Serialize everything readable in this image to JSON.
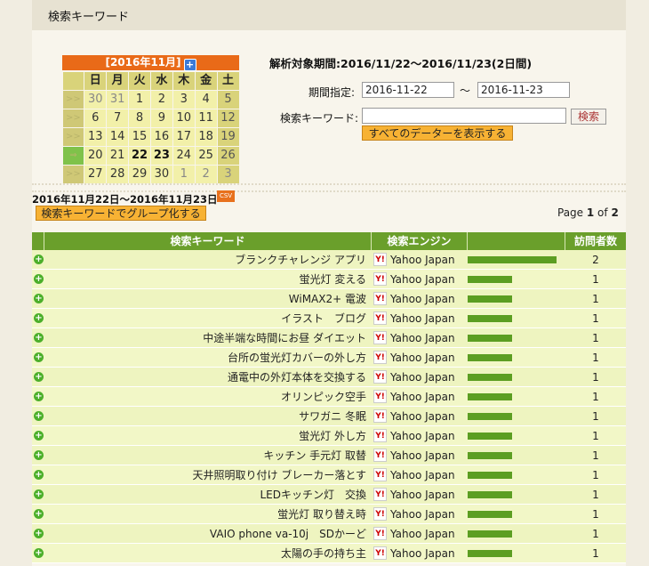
{
  "header": {
    "title": "検索キーワード"
  },
  "calendar": {
    "title": "[2016年11月]",
    "plus_icon": "+",
    "weekdays": [
      "日",
      "月",
      "火",
      "水",
      "木",
      "金",
      "土"
    ],
    "weeks": [
      {
        "arrow": ">>",
        "days": [
          "30",
          "31",
          "1",
          "2",
          "3",
          "4",
          "5"
        ]
      },
      {
        "arrow": ">>",
        "days": [
          "6",
          "7",
          "8",
          "9",
          "10",
          "11",
          "12"
        ]
      },
      {
        "arrow": ">>",
        "days": [
          "13",
          "14",
          "15",
          "16",
          "17",
          "18",
          "19"
        ]
      },
      {
        "arrow": "⇒",
        "days": [
          "20",
          "21",
          "22",
          "23",
          "24",
          "25",
          "26"
        ]
      },
      {
        "arrow": ">>",
        "days": [
          "27",
          "28",
          "29",
          "30",
          "1",
          "2",
          "3"
        ]
      }
    ]
  },
  "form": {
    "period_label": "解析対象期間:2016/11/22〜2016/11/23(2日間)",
    "date_label": "期間指定:",
    "date_from": "2016-11-22",
    "date_sep": "〜",
    "date_to": "2016-11-23",
    "keyword_label": "検索キーワード:",
    "keyword_value": "",
    "search_button": "検索",
    "show_all_button": "すべてのデーターを表示する"
  },
  "result": {
    "range_text": "2016年11月22日〜2016年11月23日",
    "csv_label": "CSV",
    "group_button": "検索キーワードでグループ化する",
    "page_prefix": "Page ",
    "page_current": "1",
    "page_of": " of ",
    "page_total": "2"
  },
  "table": {
    "headers": [
      "検索キーワード",
      "検索エンジン",
      "",
      "訪問者数"
    ],
    "rows": [
      {
        "keyword": "ブランクチャレンジ アプリ",
        "engine": "Yahoo Japan",
        "visitors": "2",
        "ratio": 1.0
      },
      {
        "keyword": "蛍光灯 変える",
        "engine": "Yahoo Japan",
        "visitors": "1",
        "ratio": 0.5
      },
      {
        "keyword": "WiMAX2+ 電波",
        "engine": "Yahoo Japan",
        "visitors": "1",
        "ratio": 0.5
      },
      {
        "keyword": "イラスト　ブログ",
        "engine": "Yahoo Japan",
        "visitors": "1",
        "ratio": 0.5
      },
      {
        "keyword": "中途半端な時間にお昼 ダイエット",
        "engine": "Yahoo Japan",
        "visitors": "1",
        "ratio": 0.5
      },
      {
        "keyword": "台所の蛍光灯カバーの外し方",
        "engine": "Yahoo Japan",
        "visitors": "1",
        "ratio": 0.5
      },
      {
        "keyword": "通電中の外灯本体を交換する",
        "engine": "Yahoo Japan",
        "visitors": "1",
        "ratio": 0.5
      },
      {
        "keyword": "オリンピック空手",
        "engine": "Yahoo Japan",
        "visitors": "1",
        "ratio": 0.5
      },
      {
        "keyword": "サワガニ 冬眠",
        "engine": "Yahoo Japan",
        "visitors": "1",
        "ratio": 0.5
      },
      {
        "keyword": "蛍光灯 外し方",
        "engine": "Yahoo Japan",
        "visitors": "1",
        "ratio": 0.5
      },
      {
        "keyword": "キッチン 手元灯 取替",
        "engine": "Yahoo Japan",
        "visitors": "1",
        "ratio": 0.5
      },
      {
        "keyword": "天井照明取り付け ブレーカー落とす",
        "engine": "Yahoo Japan",
        "visitors": "1",
        "ratio": 0.5
      },
      {
        "keyword": "LEDキッチン灯　交換",
        "engine": "Yahoo Japan",
        "visitors": "1",
        "ratio": 0.5
      },
      {
        "keyword": "蛍光灯 取り替え時",
        "engine": "Yahoo Japan",
        "visitors": "1",
        "ratio": 0.5
      },
      {
        "keyword": "VAIO phone va-10j　SDかーど",
        "engine": "Yahoo Japan",
        "visitors": "1",
        "ratio": 0.5
      },
      {
        "keyword": "太陽の手の持ち主",
        "engine": "Yahoo Japan",
        "visitors": "1",
        "ratio": 0.5
      }
    ]
  },
  "colors": {
    "accent": "#e96a18",
    "table_header": "#6a9f2b",
    "bar": "#5c9e22"
  }
}
